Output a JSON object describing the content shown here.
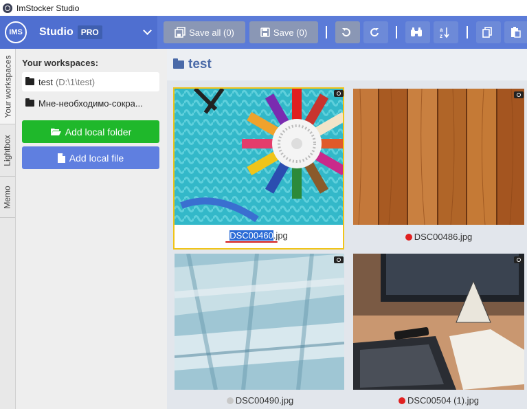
{
  "window": {
    "title": "ImStocker Studio"
  },
  "brand": {
    "logo": "IMS",
    "name": "Studio",
    "badge": "PRO"
  },
  "toolbar": {
    "save_all": "Save all (0)",
    "save": "Save (0)"
  },
  "vertical_tabs": [
    "Your workspaces",
    "Lightbox",
    "Memo"
  ],
  "sidebar": {
    "heading": "Your workspaces:",
    "workspaces": [
      {
        "name": "test",
        "path": "(D:\\1\\test)"
      },
      {
        "name": "Мне-необходимо-сокра...",
        "path": ""
      }
    ],
    "add_folder": "Add local folder",
    "add_file": "Add local file"
  },
  "main": {
    "folder_title": "test",
    "files": [
      {
        "name_sel": "DSC00460",
        "name_rest": ".jpg",
        "status_color": ""
      },
      {
        "name": "DSC00486.jpg",
        "status_color": "#e02020"
      },
      {
        "name": "DSC00490.jpg",
        "status_color": "#c8c8c8"
      },
      {
        "name": "DSC00504 (1).jpg",
        "status_color": "#e02020"
      }
    ]
  },
  "colors": {
    "toolbar": "#5b7bd8",
    "green_button": "#1fb82b",
    "blue_button": "#5f7fe0",
    "selection": "#f0c419"
  }
}
